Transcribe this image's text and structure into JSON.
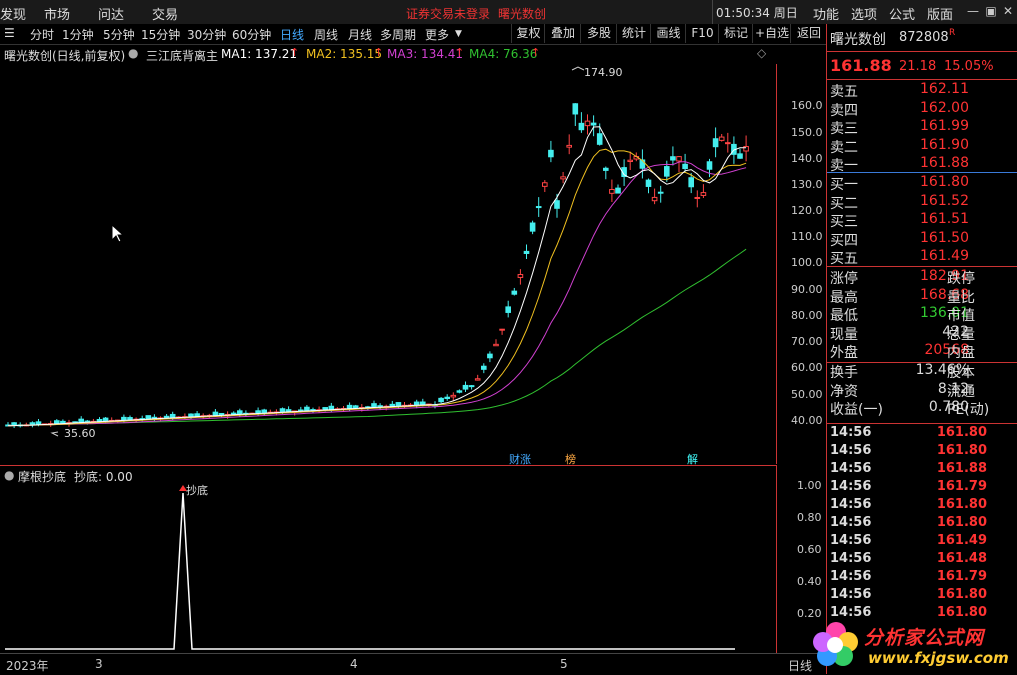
{
  "topbar": {
    "menus": [
      "发现",
      "市场",
      "问达",
      "交易"
    ],
    "warning": "证券交易未登录",
    "stock_title": "曙光数创",
    "clock": "01:50:34 周日",
    "right_menus": [
      "功能",
      "选项",
      "公式",
      "版面"
    ]
  },
  "periods": [
    "分时",
    "1分钟",
    "5分钟",
    "15分钟",
    "30分钟",
    "60分钟",
    "日线",
    "周线",
    "月线",
    "多周期",
    "更多"
  ],
  "active_period": "日线",
  "toolbar": [
    "复权",
    "叠加",
    "多股",
    "统计",
    "画线",
    "F10",
    "标记",
    "+自选",
    "返回"
  ],
  "info": {
    "name": "曙光数创(日线,前复权)",
    "indicator": "三江底背离主",
    "ma1": "MA1: 137.21",
    "ma2": "MA2: 135.15",
    "ma3": "MA3: 134.41",
    "ma4": "MA4: 76.36",
    "colors": {
      "ma1": "#ffffff",
      "ma2": "#f0c020",
      "ma3": "#d040d0",
      "ma4": "#30c030"
    }
  },
  "price_axis": [
    "160.0",
    "150.0",
    "140.0",
    "130.0",
    "120.0",
    "110.0",
    "100.0",
    "90.00",
    "80.00",
    "70.00",
    "60.00",
    "50.00",
    "40.00"
  ],
  "annotations": {
    "high": "174.90",
    "low": "35.60"
  },
  "badges": [
    {
      "label": "财涨",
      "color": "#4af"
    },
    {
      "label": "榜",
      "color": "#fa4"
    },
    {
      "label": "解",
      "color": "#4ff"
    }
  ],
  "sub": {
    "title": "摩根抄底",
    "value": "抄底: 0.00",
    "marker": "抄底",
    "axis": [
      "1.00",
      "0.80",
      "0.60",
      "0.40",
      "0.20"
    ]
  },
  "dates": [
    "2023年",
    "3",
    "4",
    "5"
  ],
  "date_axis_label": "日线",
  "panel": {
    "name": "曙光数创",
    "code": "872808",
    "code_flag": "R",
    "price": "161.88",
    "change": "21.18",
    "pct": "15.05%",
    "asks": [
      {
        "k": "卖五",
        "v": "162.11"
      },
      {
        "k": "卖四",
        "v": "162.00"
      },
      {
        "k": "卖三",
        "v": "161.99"
      },
      {
        "k": "卖二",
        "v": "161.90"
      },
      {
        "k": "卖一",
        "v": "161.88"
      }
    ],
    "bids": [
      {
        "k": "买一",
        "v": "161.80"
      },
      {
        "k": "买二",
        "v": "161.52"
      },
      {
        "k": "买三",
        "v": "161.51"
      },
      {
        "k": "买四",
        "v": "161.50"
      },
      {
        "k": "买五",
        "v": "161.49"
      }
    ],
    "stats": [
      {
        "k": "涨停",
        "v": "182.91",
        "c": "red",
        "k2": "跌停"
      },
      {
        "k": "最高",
        "v": "168.68",
        "c": "red",
        "k2": "量比"
      },
      {
        "k": "最低",
        "v": "136.01",
        "c": "grn",
        "k2": "市值"
      },
      {
        "k": "现量",
        "v": "422",
        "c": "wht",
        "k2": "总量"
      },
      {
        "k": "外盘",
        "v": "20568",
        "c": "red",
        "k2": "内盘"
      }
    ],
    "stats2": [
      {
        "k": "换手",
        "v": "13.46%",
        "k2": "股本"
      },
      {
        "k": "净资",
        "v": "8.12",
        "k2": "流通"
      },
      {
        "k": "收益(一)",
        "v": "0.780",
        "k2": "PE(动)"
      }
    ],
    "ticks": [
      {
        "t": "14:56",
        "p": "161.80"
      },
      {
        "t": "14:56",
        "p": "161.80"
      },
      {
        "t": "14:56",
        "p": "161.88"
      },
      {
        "t": "14:56",
        "p": "161.79"
      },
      {
        "t": "14:56",
        "p": "161.80"
      },
      {
        "t": "14:56",
        "p": "161.80"
      },
      {
        "t": "14:56",
        "p": "161.49"
      },
      {
        "t": "14:56",
        "p": "161.48"
      },
      {
        "t": "14:56",
        "p": "161.79"
      },
      {
        "t": "14:56",
        "p": "161.80"
      },
      {
        "t": "14:56",
        "p": "161.80"
      }
    ]
  },
  "watermark": {
    "title": "分析家公式网",
    "url": "www.fxjgsw.com"
  }
}
